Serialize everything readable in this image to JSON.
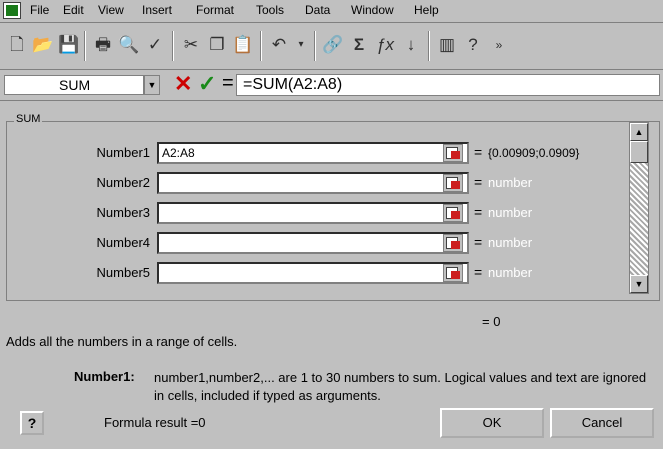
{
  "menubar": {
    "items": [
      "File",
      "Edit",
      "View",
      "Insert",
      "Format",
      "Tools",
      "Data",
      "Window",
      "Help"
    ]
  },
  "toolbar": {
    "icons": [
      "new-icon",
      "open-icon",
      "save-icon",
      "print-icon",
      "print-preview-icon",
      "spelling-icon",
      "cut-icon",
      "copy-icon",
      "paste-icon",
      "undo-icon",
      "hyperlink-icon",
      "autosum-icon",
      "function-wizard-icon",
      "sort-ascending-icon",
      "chart-wizard-icon",
      "help-icon"
    ]
  },
  "formula_bar": {
    "name_box": "SUM",
    "cancel_symbol": "✕",
    "enter_symbol": "✓",
    "equals_symbol": "=",
    "formula": "=SUM(A2:A8)"
  },
  "dialog": {
    "function_name": "SUM",
    "arguments": [
      {
        "label": "Number1",
        "value": "A2:A8",
        "result": "{0.00909;0.0909}",
        "eq": "="
      },
      {
        "label": "Number2",
        "value": "",
        "result": "number",
        "eq": "="
      },
      {
        "label": "Number3",
        "value": "",
        "result": "number",
        "eq": "="
      },
      {
        "label": "Number4",
        "value": "",
        "result": "number",
        "eq": "="
      },
      {
        "label": "Number5",
        "value": "",
        "result": "number",
        "eq": "="
      }
    ],
    "total_result": "= 0",
    "description": "Adds all the numbers in a range of cells.",
    "arg_help_name": "Number1:",
    "arg_help_text": "number1,number2,... are 1 to 30 numbers to sum. Logical values and text are ignored in cells, included if typed as arguments.",
    "help_symbol": "?",
    "formula_result": "Formula result =0",
    "ok_label": "OK",
    "cancel_label": "Cancel"
  }
}
